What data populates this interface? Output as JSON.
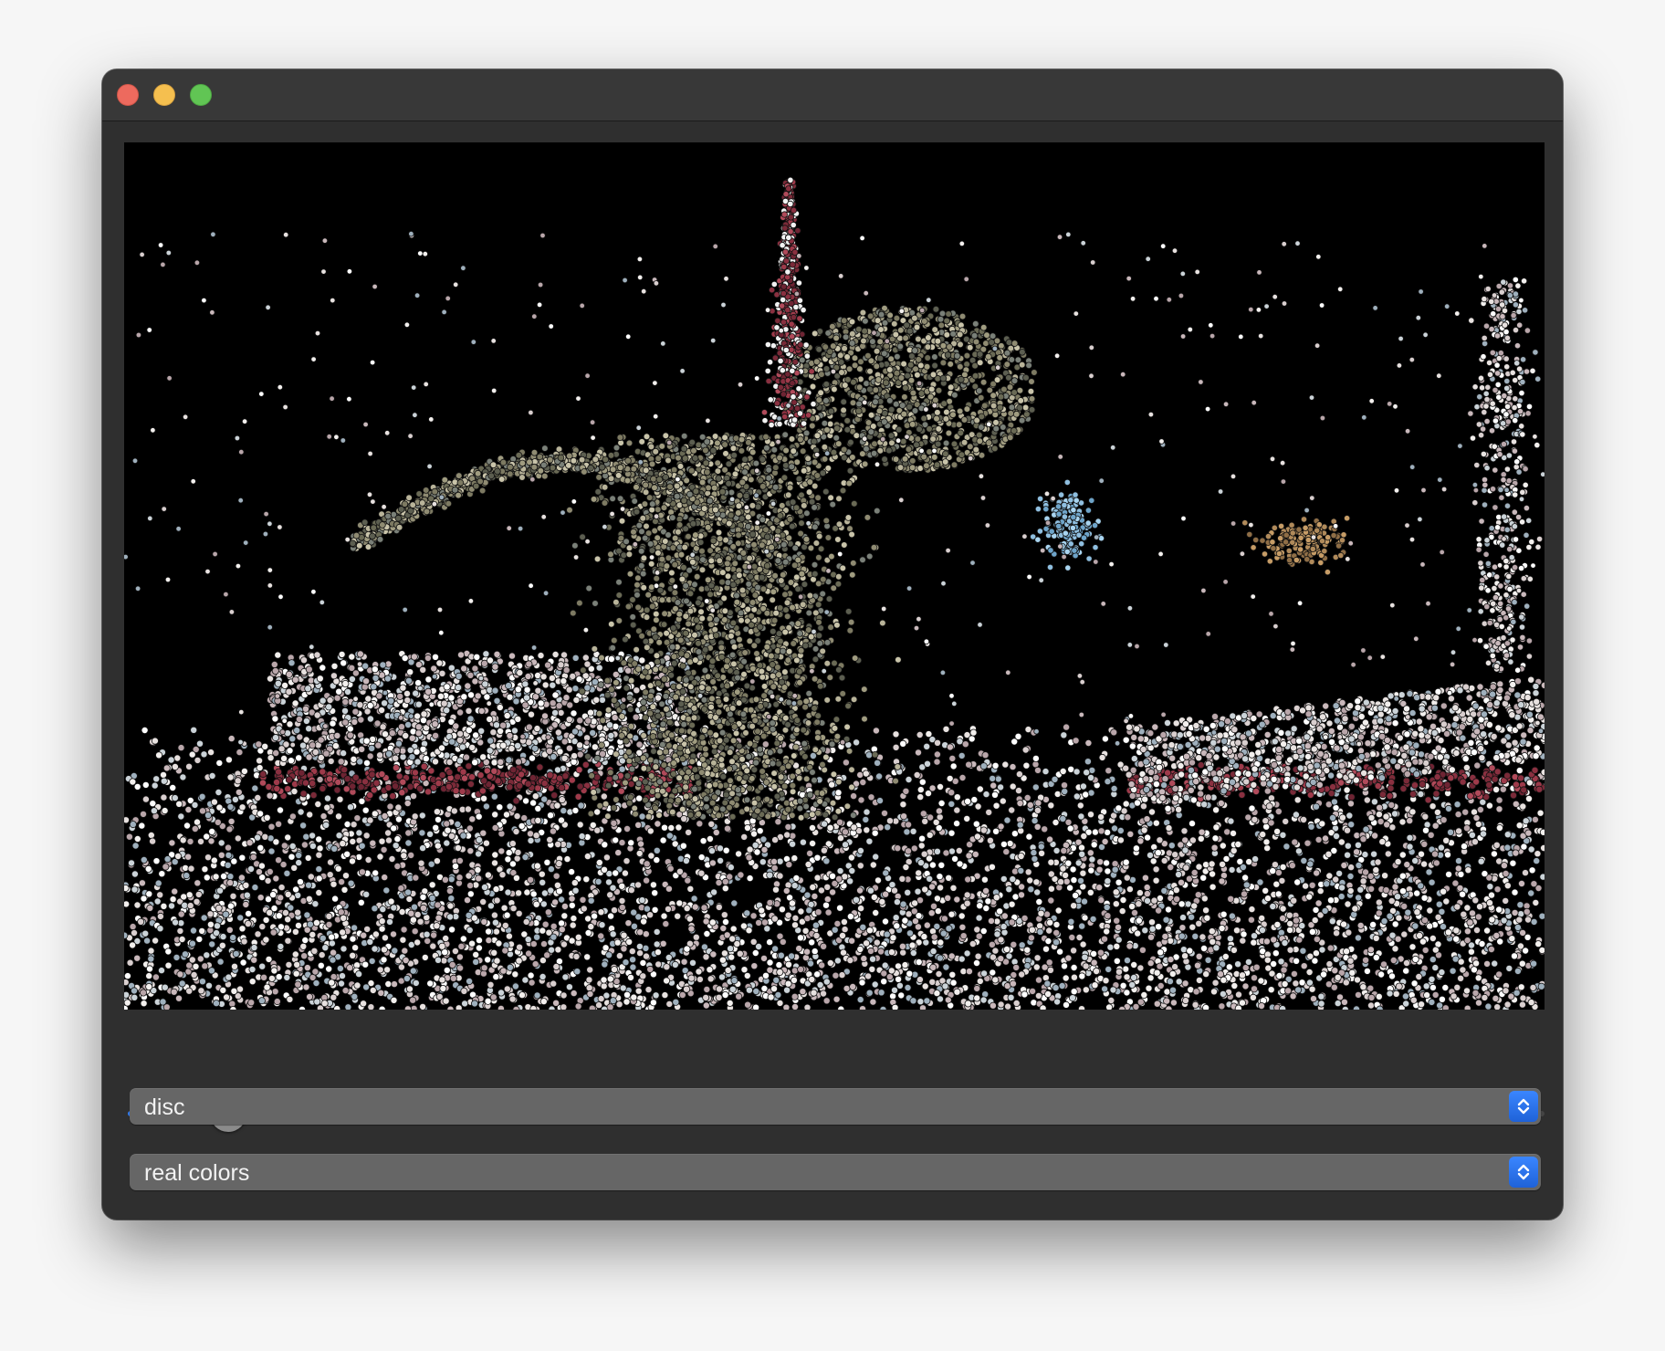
{
  "window": {
    "controls": {
      "close": "close-button",
      "minimize": "minimize-button",
      "zoom": "zoom-button"
    }
  },
  "viewer": {
    "content": "point-cloud rendering"
  },
  "slider": {
    "value": 0.04
  },
  "point_style_select": {
    "value": "disc"
  },
  "color_mode_select": {
    "value": "real colors"
  },
  "colors": {
    "accent": "#2f7df6",
    "window_bg": "#2f2f2f",
    "viewport_bg": "#000000"
  },
  "icons": [
    "chevron-up-down-icon"
  ]
}
